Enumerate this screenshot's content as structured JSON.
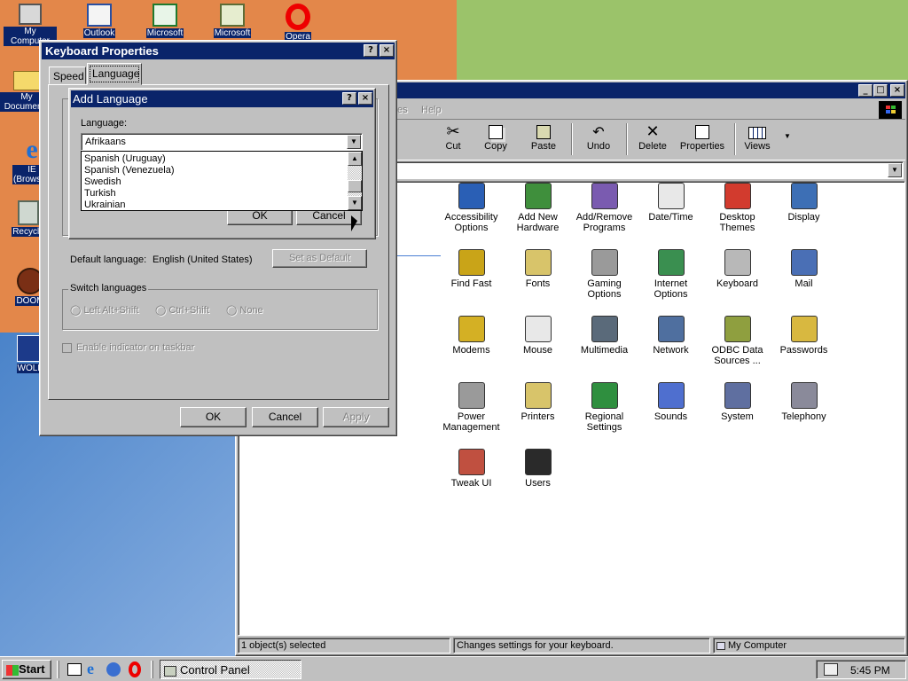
{
  "desktop": {
    "icons": [
      {
        "label": "My Computer"
      },
      {
        "label": "Outlook"
      },
      {
        "label": "Microsoft"
      },
      {
        "label": "Microsoft"
      },
      {
        "label": "Opera"
      },
      {
        "label": "My Documents"
      },
      {
        "label": "IE (Browser)"
      },
      {
        "label": "Recycle"
      },
      {
        "label": "DOOM"
      },
      {
        "label": "WOLF"
      }
    ]
  },
  "control_panel": {
    "menu_help": "Help",
    "toolbar": [
      {
        "label": "Cut",
        "icon": "scissors-icon"
      },
      {
        "label": "Copy",
        "icon": "copy-icon"
      },
      {
        "label": "Paste",
        "icon": "paste-icon"
      },
      {
        "label": "Undo",
        "icon": "undo-icon"
      },
      {
        "label": "Delete",
        "icon": "delete-icon"
      },
      {
        "label": "Properties",
        "icon": "properties-icon"
      },
      {
        "label": "Views",
        "icon": "views-icon"
      }
    ],
    "items": [
      {
        "line1": "Accessibility",
        "line2": "Options"
      },
      {
        "line1": "Add New",
        "line2": "Hardware"
      },
      {
        "line1": "Add/Remove",
        "line2": "Programs"
      },
      {
        "line1": "Date/Time",
        "line2": ""
      },
      {
        "line1": "Desktop",
        "line2": "Themes"
      },
      {
        "line1": "Display",
        "line2": ""
      },
      {
        "line1": "Find Fast",
        "line2": ""
      },
      {
        "line1": "Fonts",
        "line2": ""
      },
      {
        "line1": "Gaming",
        "line2": "Options"
      },
      {
        "line1": "Internet",
        "line2": "Options"
      },
      {
        "line1": "Keyboard",
        "line2": ""
      },
      {
        "line1": "Mail",
        "line2": ""
      },
      {
        "line1": "Modems",
        "line2": ""
      },
      {
        "line1": "Mouse",
        "line2": ""
      },
      {
        "line1": "Multimedia",
        "line2": ""
      },
      {
        "line1": "Network",
        "line2": ""
      },
      {
        "line1": "ODBC Data",
        "line2": "Sources ..."
      },
      {
        "line1": "Passwords",
        "line2": ""
      },
      {
        "line1": "Power",
        "line2": "Management"
      },
      {
        "line1": "Printers",
        "line2": ""
      },
      {
        "line1": "Regional",
        "line2": "Settings"
      },
      {
        "line1": "Sounds",
        "line2": ""
      },
      {
        "line1": "System",
        "line2": ""
      },
      {
        "line1": "Telephony",
        "line2": ""
      },
      {
        "line1": "Tweak UI",
        "line2": ""
      },
      {
        "line1": "Users",
        "line2": ""
      }
    ],
    "status": {
      "selected": "1 object(s) selected",
      "description": "Changes settings for your keyboard.",
      "location": "My Computer"
    }
  },
  "keyboard_props": {
    "title": "Keyboard Properties",
    "tabs": [
      "Speed",
      "Language"
    ],
    "default_language_label": "Default language:",
    "default_language_value": "English (United States)",
    "set_default": "Set as Default",
    "switch_group": "Switch languages",
    "radio_left": "Left Alt+Shift",
    "radio_ctrl": "Ctrl+Shift",
    "radio_none": "None",
    "indicator": "Enable indicator on taskbar",
    "ok": "OK",
    "cancel": "Cancel",
    "apply": "Apply"
  },
  "add_language": {
    "title": "Add Language",
    "label": "Language:",
    "selected": "Afrikaans",
    "options": [
      "Spanish (Uruguay)",
      "Spanish (Venezuela)",
      "Swedish",
      "Turkish",
      "Ukrainian"
    ],
    "ok": "OK",
    "cancel": "Cancel"
  },
  "taskbar": {
    "start": "Start",
    "task": "Control Panel",
    "time": "5:45 PM"
  }
}
